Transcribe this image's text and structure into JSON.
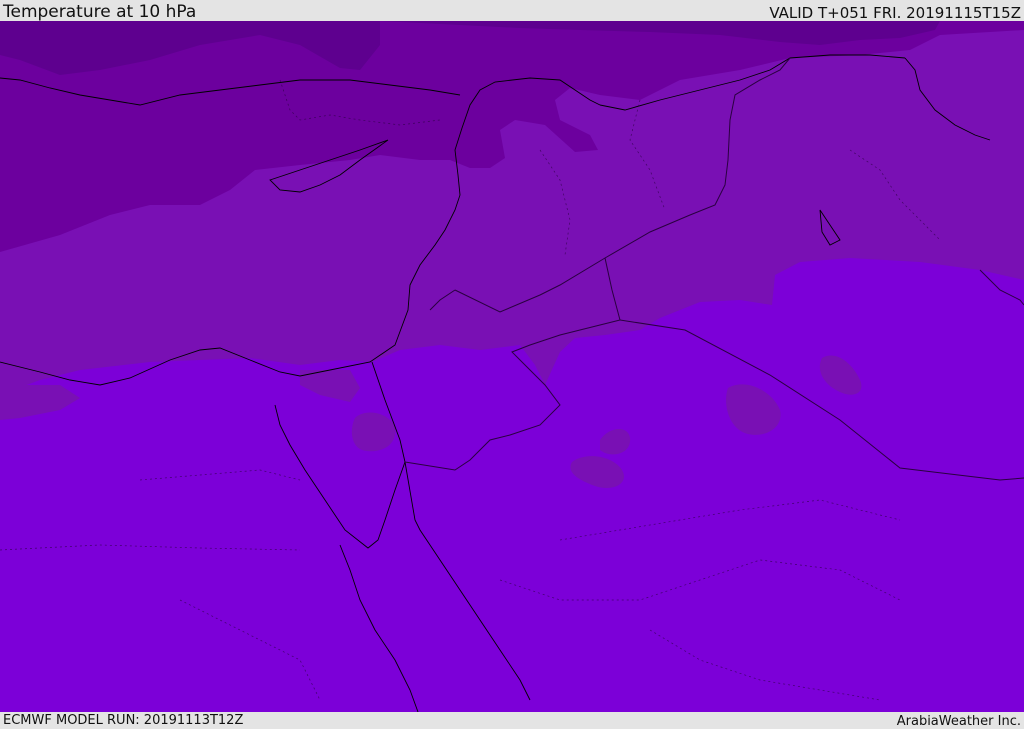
{
  "header": {
    "title": "Temperature at 10 hPa",
    "valid": "VALID T+051 FRI. 20191115T15Z"
  },
  "footer": {
    "model_run": "ECMWF MODEL RUN: 20191113T12Z",
    "credit": "ArabiaWeather Inc."
  },
  "colors": {
    "band_coldest": "#5e008f",
    "band_cold": "#6c009e",
    "band_mid": "#7910b4",
    "band_warm": "#7c00d8",
    "coastline": "#000000",
    "border": "#2a0040"
  }
}
